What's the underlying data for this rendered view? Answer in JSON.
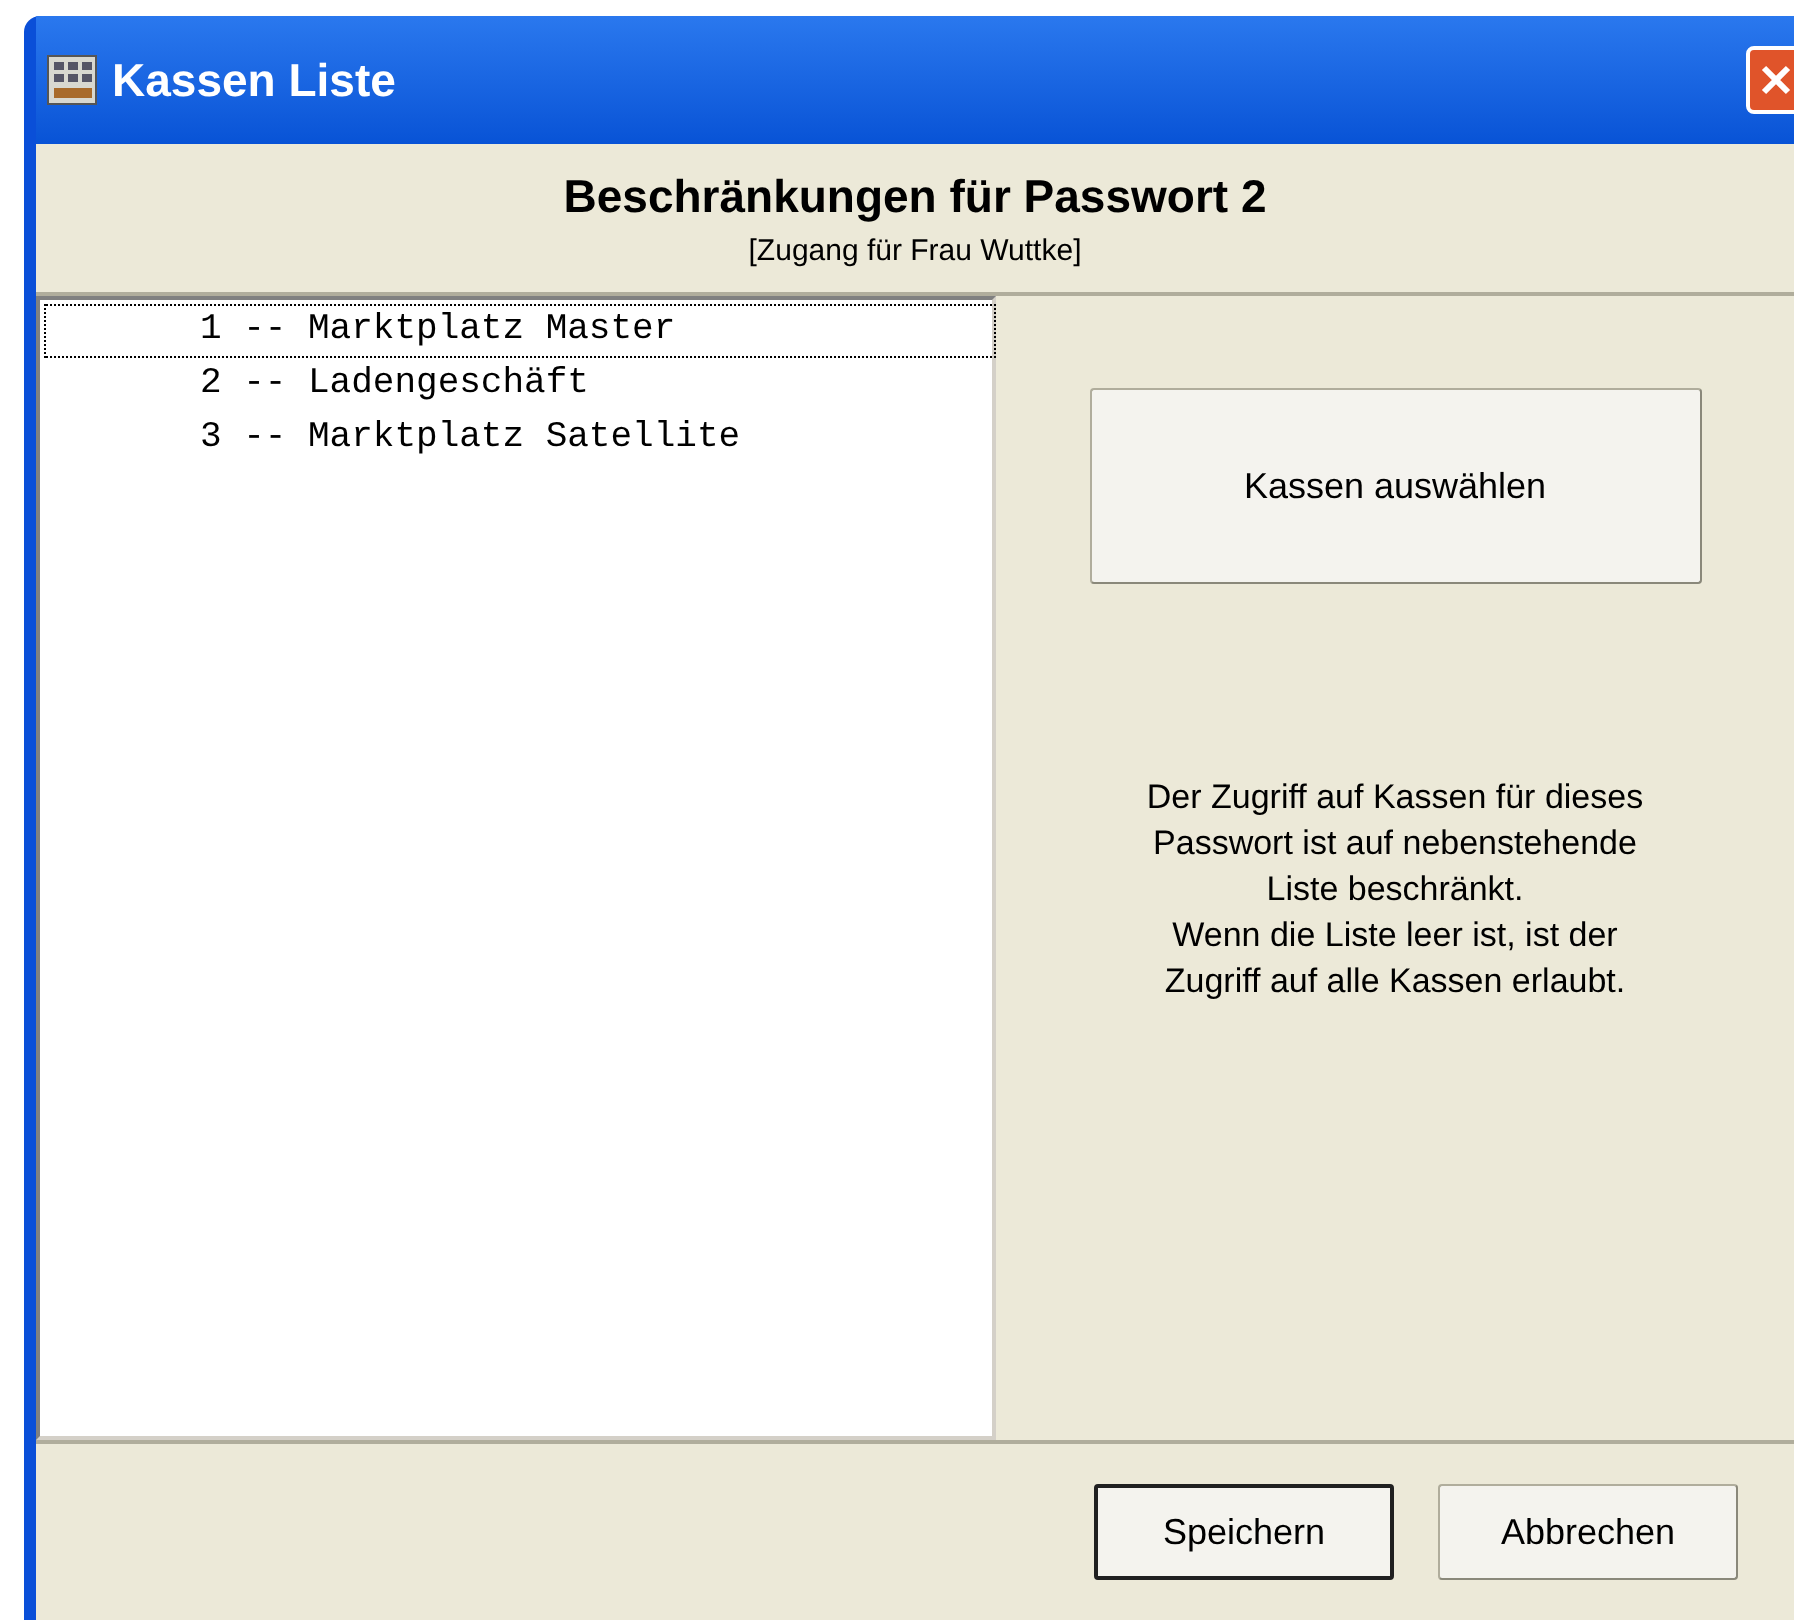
{
  "window": {
    "title": "Kassen Liste"
  },
  "header": {
    "title": "Beschränkungen für Passwort 2",
    "subtitle": "[Zugang für Frau Wuttke]"
  },
  "list": [
    {
      "label": "1 -- Marktplatz Master",
      "focused": true
    },
    {
      "label": "2 -- Ladengeschäft",
      "focused": false
    },
    {
      "label": "3 -- Marktplatz Satellite",
      "focused": false
    }
  ],
  "select_button": "Kassen auswählen",
  "info": [
    "Der Zugriff auf Kassen für dieses Passwort ist auf nebenstehende Liste beschränkt.",
    "Wenn die Liste leer ist, ist der Zugriff auf alle Kassen erlaubt."
  ],
  "buttons": [
    {
      "label": "Speichern",
      "default": true
    },
    {
      "label": "Abbrechen",
      "default": false
    }
  ]
}
